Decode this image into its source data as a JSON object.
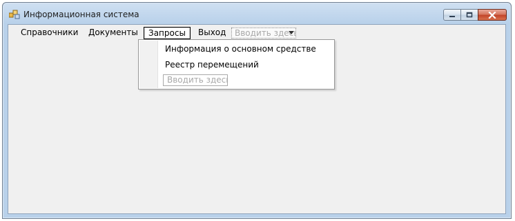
{
  "window": {
    "title": "Информационная система",
    "icon": "app-icon",
    "caption_buttons": [
      "minimize-icon",
      "maximize-icon",
      "close-icon"
    ],
    "colors": {
      "frame": "#b9d1ea",
      "client": "#f0f0f0",
      "close_button": "#c2452a"
    }
  },
  "menubar": {
    "items": [
      {
        "label": "Справочники",
        "active": false
      },
      {
        "label": "Документы",
        "active": false
      },
      {
        "label": "Запросы",
        "active": true
      },
      {
        "label": "Выход",
        "active": false
      }
    ],
    "type_here": "Вводить здесь"
  },
  "dropdown": {
    "items": [
      {
        "label": "Информация о основном средстве"
      },
      {
        "label": "Реестр перемещений"
      }
    ],
    "type_here": "Вводить здесь"
  }
}
